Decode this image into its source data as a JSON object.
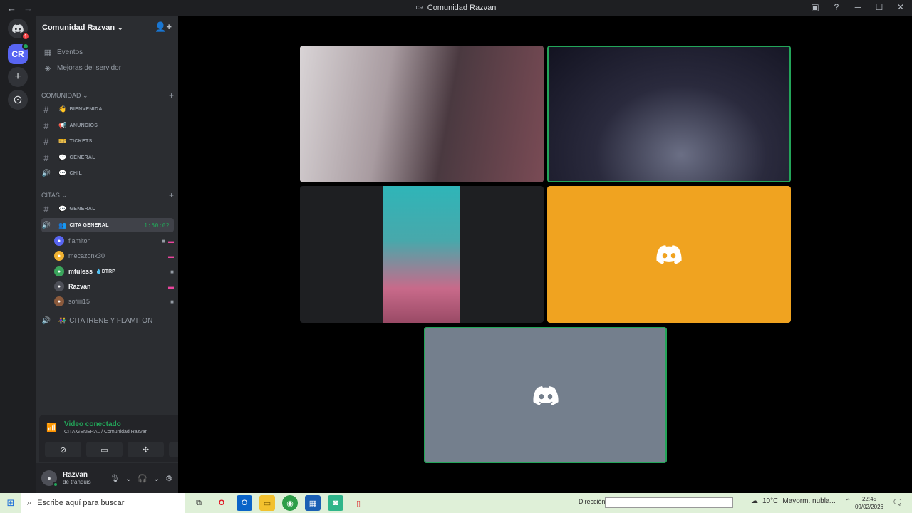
{
  "window": {
    "title": "Comunidad Razvan",
    "title_badge": "CR"
  },
  "servers": {
    "home_badge": "1",
    "active_initials": "CR"
  },
  "guild": {
    "name": "Comunidad Razvan"
  },
  "nav": [
    {
      "label": "Eventos",
      "icon": "calendar-icon"
    },
    {
      "label": "Mejoras del servidor",
      "icon": "boost-icon"
    }
  ],
  "categories": {
    "comunidad": {
      "label": "COMUNIDAD"
    },
    "citas": {
      "label": "CITAS"
    }
  },
  "channels_comunidad": [
    {
      "name": "BIENVENIDA",
      "emoji": "👋",
      "kind": "text"
    },
    {
      "name": "ANUNCIOS",
      "emoji": "📢",
      "kind": "text"
    },
    {
      "name": "TICKETS",
      "emoji": "🎫",
      "kind": "text"
    },
    {
      "name": "GENERAL",
      "emoji": "💬",
      "kind": "text"
    },
    {
      "name": "CHIL",
      "emoji": "💬",
      "kind": "voice"
    }
  ],
  "channels_citas": {
    "general": {
      "name": "GENERAL",
      "emoji": "💬"
    },
    "active_voice": {
      "name": "CITA GENERAL",
      "timer": "1:50:02"
    },
    "voice2": {
      "name": "CITA IRENE Y FLAMITON"
    }
  },
  "voice_users": [
    {
      "name": "flamiton",
      "bold": false,
      "tag": "",
      "color": "#5865f2"
    },
    {
      "name": "mecazonx30",
      "bold": false,
      "tag": "",
      "color": "#f0b232"
    },
    {
      "name": "mtuless",
      "bold": true,
      "tag": "DTRP",
      "color": "#3ba55c"
    },
    {
      "name": "Razvan",
      "bold": true,
      "tag": "",
      "color": "#4e5058"
    },
    {
      "name": "sofiiii15",
      "bold": false,
      "tag": "",
      "color": "#8b5a3c"
    }
  ],
  "voice_panel": {
    "status": "Video conectado",
    "location": "CITA GENERAL / Comunidad Razvan"
  },
  "user_panel": {
    "name": "Razvan",
    "status": "de tranquis"
  },
  "tiles": [
    {
      "label": "participant-video-1",
      "bg": "#6b5a5e"
    },
    {
      "label": "participant-video-2",
      "bg": "#1c1c2e"
    },
    {
      "label": "participant-video-3",
      "bg": "#1e1f22"
    },
    {
      "label": "participant-avatar-4",
      "bg": "#f0a320"
    },
    {
      "label": "participant-avatar-5",
      "bg": "#747f8d"
    }
  ],
  "taskbar": {
    "search_placeholder": "Escribe aquí para buscar",
    "address_label": "Dirección",
    "temperature": "10°C",
    "weather": "Mayorm. nubla...",
    "time": "22:45",
    "date": "09/02/2026"
  }
}
